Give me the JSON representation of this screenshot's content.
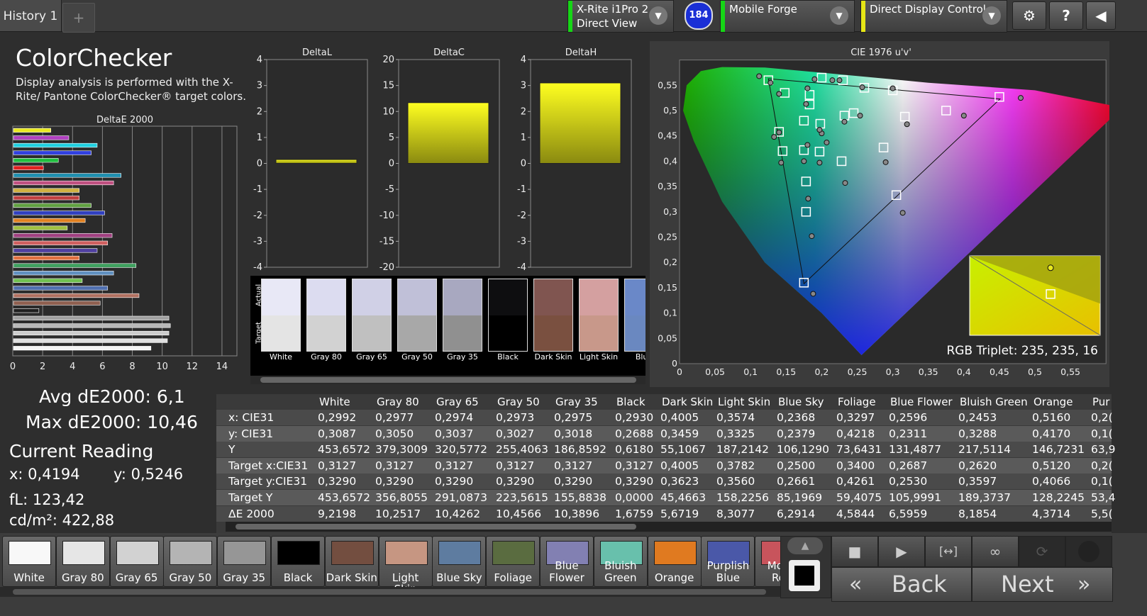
{
  "topbar": {
    "tab_label": "History 1",
    "add_tab": "+",
    "device1": {
      "line1": "X-Rite i1Pro 2",
      "line2": "Direct View",
      "color": "#16d616"
    },
    "badge": "184",
    "device2": {
      "label": "Mobile Forge",
      "color": "#16d616"
    },
    "device3": {
      "label": "Direct Display Control",
      "color": "#e6e616"
    },
    "settings": "⚙",
    "help": "?",
    "collapse": "◀"
  },
  "panel": {
    "title": "ColorChecker",
    "description": "Display analysis is performed with the X-Rite/ Pantone ColorChecker® target colors."
  },
  "de_chart": {
    "title": "DeltaE 2000",
    "ticks": [
      "0",
      "2",
      "4",
      "6",
      "8",
      "10",
      "12",
      "14"
    ],
    "bars": [
      {
        "v": 2.5,
        "c": "#e8e820"
      },
      {
        "v": 3.7,
        "c": "#b040c0"
      },
      {
        "v": 5.6,
        "c": "#20d0e0"
      },
      {
        "v": 5.2,
        "c": "#3040e0"
      },
      {
        "v": 3,
        "c": "#20c040"
      },
      {
        "v": 2,
        "c": "#e02020"
      },
      {
        "v": 7.2,
        "c": "#2090b0"
      },
      {
        "v": 6.7,
        "c": "#c05080"
      },
      {
        "v": 4.4,
        "c": "#d0b040"
      },
      {
        "v": 4.4,
        "c": "#c04040"
      },
      {
        "v": 5.2,
        "c": "#60a040"
      },
      {
        "v": 6.1,
        "c": "#3040c0"
      },
      {
        "v": 4.8,
        "c": "#e08020"
      },
      {
        "v": 3.6,
        "c": "#a0c040"
      },
      {
        "v": 6.6,
        "c": "#a04080"
      },
      {
        "v": 6.3,
        "c": "#d06060"
      },
      {
        "v": 5.6,
        "c": "#5040a0"
      },
      {
        "v": 4.4,
        "c": "#e07040"
      },
      {
        "v": 8.2,
        "c": "#40a060"
      },
      {
        "v": 6.7,
        "c": "#6090c0"
      },
      {
        "v": 4.6,
        "c": "#70c050"
      },
      {
        "v": 6.3,
        "c": "#5070b0"
      },
      {
        "v": 8.4,
        "c": "#b07060"
      },
      {
        "v": 5.8,
        "c": "#906050"
      },
      {
        "v": 1.7,
        "c": "#202020"
      },
      {
        "v": 10.4,
        "c": "#a0a0a0"
      },
      {
        "v": 10.5,
        "c": "#b8b8b8"
      },
      {
        "v": 10.4,
        "c": "#cccccc"
      },
      {
        "v": 10.3,
        "c": "#e0e0e0"
      },
      {
        "v": 9.2,
        "c": "#f4f4f4"
      }
    ]
  },
  "delta_charts": [
    {
      "title": "DeltaL",
      "ticks": [
        "4",
        "3",
        "2",
        "1",
        "0",
        "-1",
        "-2",
        "-3",
        "-4"
      ],
      "max": 4,
      "value": 0.15
    },
    {
      "title": "DeltaC",
      "ticks": [
        "20",
        "15",
        "10",
        "5",
        "0",
        "-5",
        "-10",
        "-15",
        "-20"
      ],
      "max": 20,
      "value": 11.7
    },
    {
      "title": "DeltaH",
      "ticks": [
        "4",
        "3",
        "2",
        "1",
        "0",
        "-1",
        "-2",
        "-3",
        "-4"
      ],
      "max": 4,
      "value": 3.1
    }
  ],
  "swatch_strip": {
    "actual_label": "Actual",
    "target_label": "Target",
    "items": [
      {
        "name": "White",
        "actual": "#e8e8f6",
        "target": "#e4e4e4"
      },
      {
        "name": "Gray 80",
        "actual": "#dcdcf0",
        "target": "#d2d2d2"
      },
      {
        "name": "Gray 65",
        "actual": "#d0d0e6",
        "target": "#c0c0c0"
      },
      {
        "name": "Gray 50",
        "actual": "#c0c0d8",
        "target": "#a8a8a8"
      },
      {
        "name": "Gray 35",
        "actual": "#a8a8c0",
        "target": "#909090"
      },
      {
        "name": "Black",
        "actual": "#0e0e10",
        "target": "#000000"
      },
      {
        "name": "Dark Skin",
        "actual": "#805550",
        "target": "#7a5040"
      },
      {
        "name": "Light Skin",
        "actual": "#d4a0a0",
        "target": "#c8988a"
      },
      {
        "name": "Blue",
        "actual": "#6a88c8",
        "target": "#6a88c0"
      }
    ]
  },
  "cie": {
    "title": "CIE 1976 u'v'",
    "x_ticks": [
      "0",
      "0,05",
      "0,1",
      "0,15",
      "0,2",
      "0,25",
      "0,3",
      "0,35",
      "0,4",
      "0,45",
      "0,5",
      "0,55"
    ],
    "y_ticks": [
      "0,55",
      "0,5",
      "0,45",
      "0,4",
      "0,35",
      "0,3",
      "0,25",
      "0,2",
      "0,15",
      "0,1",
      "0,05",
      "0"
    ],
    "rgb_triplet": "RGB Triplet: 235, 235, 16",
    "targets": [
      [
        0.125,
        0.56
      ],
      [
        0.148,
        0.535
      ],
      [
        0.183,
        0.531
      ],
      [
        0.2,
        0.565
      ],
      [
        0.23,
        0.56
      ],
      [
        0.26,
        0.545
      ],
      [
        0.3,
        0.54
      ],
      [
        0.183,
        0.512
      ],
      [
        0.175,
        0.48
      ],
      [
        0.14,
        0.458
      ],
      [
        0.198,
        0.474
      ],
      [
        0.232,
        0.49
      ],
      [
        0.245,
        0.495
      ],
      [
        0.317,
        0.488
      ],
      [
        0.375,
        0.5
      ],
      [
        0.45,
        0.527
      ],
      [
        0.145,
        0.42
      ],
      [
        0.175,
        0.422
      ],
      [
        0.197,
        0.419
      ],
      [
        0.228,
        0.4
      ],
      [
        0.287,
        0.427
      ],
      [
        0.178,
        0.36
      ],
      [
        0.305,
        0.333
      ],
      [
        0.178,
        0.3
      ],
      [
        0.175,
        0.16
      ]
    ],
    "measured": [
      [
        0.112,
        0.568
      ],
      [
        0.14,
        0.533
      ],
      [
        0.178,
        0.513
      ],
      [
        0.18,
        0.544
      ],
      [
        0.19,
        0.562
      ],
      [
        0.215,
        0.56
      ],
      [
        0.225,
        0.56
      ],
      [
        0.257,
        0.546
      ],
      [
        0.3,
        0.544
      ],
      [
        0.128,
        0.555
      ],
      [
        0.133,
        0.448
      ],
      [
        0.14,
        0.457
      ],
      [
        0.2,
        0.455
      ],
      [
        0.197,
        0.462
      ],
      [
        0.207,
        0.437
      ],
      [
        0.232,
        0.478
      ],
      [
        0.254,
        0.49
      ],
      [
        0.32,
        0.473
      ],
      [
        0.4,
        0.49
      ],
      [
        0.48,
        0.525
      ],
      [
        0.143,
        0.397
      ],
      [
        0.175,
        0.4
      ],
      [
        0.18,
        0.432
      ],
      [
        0.197,
        0.397
      ],
      [
        0.29,
        0.398
      ],
      [
        0.233,
        0.357
      ],
      [
        0.181,
        0.326
      ],
      [
        0.314,
        0.298
      ],
      [
        0.186,
        0.252
      ],
      [
        0.188,
        0.138
      ]
    ],
    "inset": {
      "target": [
        0.62,
        0.48
      ],
      "measured": [
        0.62,
        0.15
      ]
    }
  },
  "stats": {
    "avg": "Avg dE2000: 6,1",
    "max": "Max dE2000: 10,46",
    "current": "Current Reading",
    "x": "x: 0,4194",
    "y": "y: 0,5246",
    "fl": "fL: 123,42",
    "cd": "cd/m²: 422,88"
  },
  "table": {
    "headers": [
      "White",
      "Gray 80",
      "Gray 65",
      "Gray 50",
      "Gray 35",
      "Black",
      "Dark Skin",
      "Light Skin",
      "Blue Sky",
      "Foliage",
      "Blue Flower",
      "Bluish Green",
      "Orange",
      "Pur"
    ],
    "rows": [
      {
        "label": "x: CIE31",
        "cells": [
          "0,2992",
          "0,2977",
          "0,2974",
          "0,2973",
          "0,2975",
          "0,2930",
          "0,4005",
          "0,3574",
          "0,2368",
          "0,3297",
          "0,2596",
          "0,2453",
          "0,5160",
          "0,2("
        ]
      },
      {
        "label": "y: CIE31",
        "cells": [
          "0,3087",
          "0,3050",
          "0,3037",
          "0,3027",
          "0,3018",
          "0,2688",
          "0,3459",
          "0,3325",
          "0,2379",
          "0,4218",
          "0,2311",
          "0,3288",
          "0,4170",
          "0,1("
        ]
      },
      {
        "label": "Y",
        "cells": [
          "453,6572",
          "379,3009",
          "320,5772",
          "255,4063",
          "186,8592",
          "0,6180",
          "55,1067",
          "187,2142",
          "106,1290",
          "73,6431",
          "131,4877",
          "217,5114",
          "146,7231",
          "63,9"
        ]
      },
      {
        "label": "Target x:CIE31",
        "cells": [
          "0,3127",
          "0,3127",
          "0,3127",
          "0,3127",
          "0,3127",
          "0,3127",
          "0,4005",
          "0,3782",
          "0,2500",
          "0,3400",
          "0,2687",
          "0,2620",
          "0,5120",
          "0,2("
        ]
      },
      {
        "label": "Target y:CIE31",
        "cells": [
          "0,3290",
          "0,3290",
          "0,3290",
          "0,3290",
          "0,3290",
          "0,3290",
          "0,3623",
          "0,3560",
          "0,2661",
          "0,4261",
          "0,2530",
          "0,3597",
          "0,4066",
          "0,1("
        ]
      },
      {
        "label": "Target Y",
        "cells": [
          "453,6572",
          "356,8055",
          "291,0873",
          "223,5615",
          "155,8838",
          "0,0000",
          "45,4663",
          "158,2256",
          "85,1969",
          "59,4075",
          "105,9991",
          "189,3737",
          "128,2245",
          "53,4"
        ]
      },
      {
        "label": "ΔE 2000",
        "cells": [
          "9,2198",
          "10,2517",
          "10,4262",
          "10,4566",
          "10,3896",
          "1,6759",
          "5,6719",
          "8,3077",
          "6,2914",
          "4,5844",
          "6,5959",
          "8,1854",
          "4,3714",
          "5,5("
        ]
      }
    ]
  },
  "patches": [
    {
      "l1": "",
      "l2": "White",
      "c": "#f8f8f8"
    },
    {
      "l1": "",
      "l2": "Gray 80",
      "c": "#e6e6e6"
    },
    {
      "l1": "",
      "l2": "Gray 65",
      "c": "#d2d2d2"
    },
    {
      "l1": "",
      "l2": "Gray 50",
      "c": "#b4b4b4"
    },
    {
      "l1": "",
      "l2": "Gray 35",
      "c": "#969696"
    },
    {
      "l1": "",
      "l2": "Black",
      "c": "#000000"
    },
    {
      "l1": "",
      "l2": "Dark Skin",
      "c": "#734e40"
    },
    {
      "l1": "",
      "l2": "Light Skin",
      "c": "#c69682"
    },
    {
      "l1": "",
      "l2": "Blue Sky",
      "c": "#5e7ca0"
    },
    {
      "l1": "",
      "l2": "Foliage",
      "c": "#5a6c40"
    },
    {
      "l1": "Blue",
      "l2": "Flower",
      "c": "#8280b2"
    },
    {
      "l1": "Bluish",
      "l2": "Green",
      "c": "#68c0ac"
    },
    {
      "l1": "",
      "l2": "Orange",
      "c": "#e07a20"
    },
    {
      "l1": "Purplish",
      "l2": "Blue",
      "c": "#4a58a8"
    },
    {
      "l1": "Mode",
      "l2": "Red",
      "c": "#c8545c"
    }
  ],
  "controls": {
    "up": "▲",
    "stop": "■",
    "play": "▶",
    "fit": "[↔]",
    "loop": "∞",
    "refresh": "⟳",
    "back": "Back",
    "next": "Next",
    "back_icon": "«",
    "next_icon": "»"
  }
}
